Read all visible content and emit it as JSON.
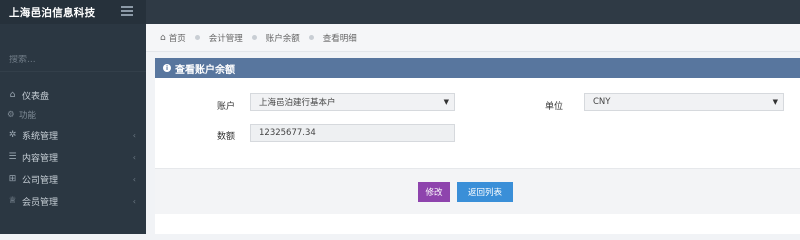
{
  "sidebar": {
    "brand": "上海邑泊信息科技",
    "search_placeholder": "搜索...",
    "dashboard": "仪表盘",
    "section_label": "功能",
    "items": [
      {
        "label": "系统管理"
      },
      {
        "label": "内容管理"
      },
      {
        "label": "公司管理"
      },
      {
        "label": "会员管理"
      }
    ]
  },
  "breadcrumb": [
    "首页",
    "会计管理",
    "账户余额",
    "查看明细"
  ],
  "panel": {
    "title": "查看账户余额",
    "account_label": "账户",
    "account_value": "上海邑泊建行基本户",
    "unit_label": "单位",
    "unit_value": "CNY",
    "amount_label": "数额",
    "amount_value": "12325677.34",
    "edit_button": "修改",
    "back_button": "返回列表"
  }
}
